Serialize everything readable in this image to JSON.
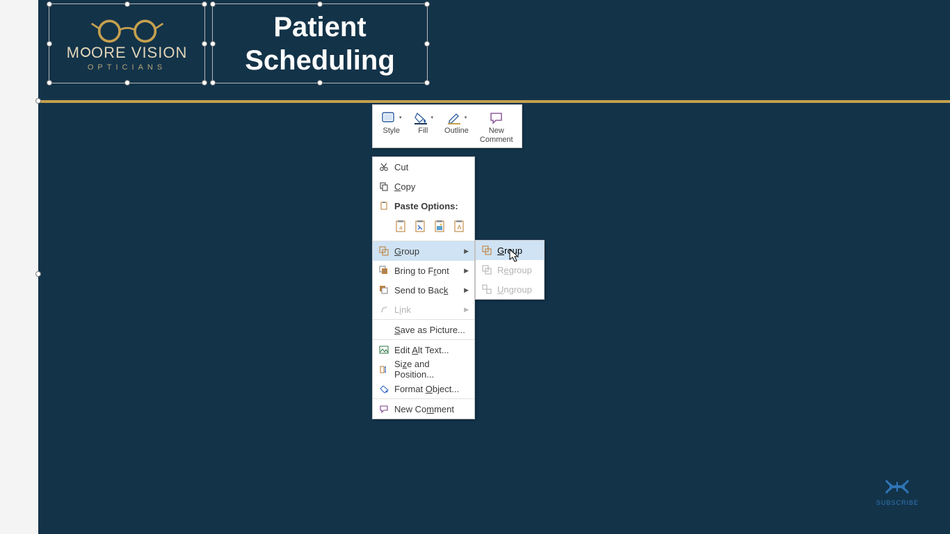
{
  "slide": {
    "logo": {
      "line1_a": "M",
      "line1_b": "ORE VISION",
      "line2": "OPTICIANS"
    },
    "title": "Patient\nScheduling"
  },
  "mini_toolbar": {
    "style": "Style",
    "fill": "Fill",
    "outline": "Outline",
    "new_comment": "New\nComment"
  },
  "context_menu": {
    "cut": "Cut",
    "copy": "Copy",
    "paste_options": "Paste Options:",
    "group": "Group",
    "bring_front": "Bring to Front",
    "send_back": "Send to Back",
    "link": "Link",
    "save_as_picture": "Save as Picture...",
    "edit_alt_text": "Edit Alt Text...",
    "size_and_position": "Size and Position...",
    "format_object": "Format Object...",
    "new_comment": "New Comment"
  },
  "submenu": {
    "group": "Group",
    "regroup": "Regroup",
    "ungroup": "Ungroup"
  },
  "subscribe": "SUBSCRIBE"
}
